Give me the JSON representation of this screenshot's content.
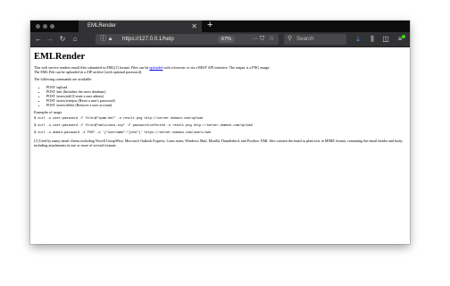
{
  "tab": {
    "title": "EMLRender"
  },
  "nav": {
    "url": "https://127.0.0.1/help",
    "zoom": "67%",
    "search_placeholder": "Search"
  },
  "page": {
    "title": "EMLRender",
    "intro_before_link": "This web service renders email files submitted in EML[1] format. Files can be ",
    "intro_link": "uploaded",
    "intro_after_link": " with a browser or via a REST API interface. The output is a PNG image.",
    "intro_line2": "The EML File can be uploaded in a ZIP archive (with optional password).",
    "commands_heading": "The following commands are available:",
    "commands": [
      "POST /upload",
      "POST /init (Initialize the users database)",
      "POST /users/add (Create a user admin)",
      "POST /users/resetpw (Reset a user's password)",
      "POST /users/delete (Remove a user account)"
    ],
    "examples_heading": "Examples of usage:",
    "examples": [
      "$ curl -u user:password -F file=@\"spam.eml\" -o result.png http://server.domain.com/upload",
      "$ curl -u user:password -F file=@\"malicious.zip\" -F password=infected -o result.png http://server.domain.com/upload",
      "$ curl -u admin:password -X POST -d '{\"username\":\"john\"}' https://server.domain.com/users/add"
    ],
    "footnote": "[1] Used by many email clients including Novell GroupWise, Microsoft Outlook Express, Lotus notes, Windows Mail, Mozilla Thunderbird, and Postbox. EML files contain the email as plain text in MIME format, containing the email header and body, including attachments in one or more of several formats."
  }
}
